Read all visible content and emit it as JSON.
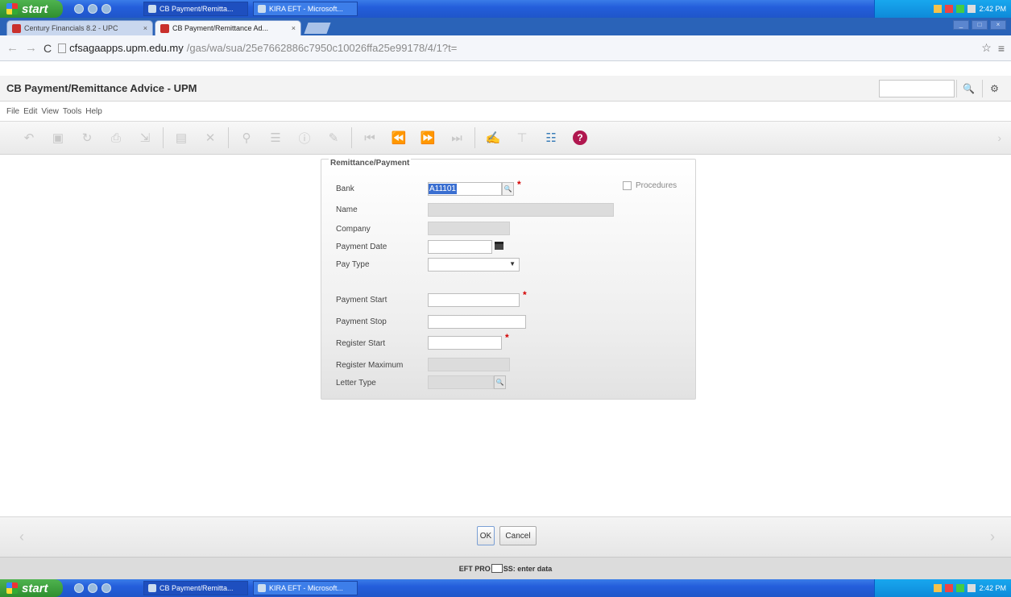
{
  "taskbar": {
    "start_label": "start",
    "tasks": [
      "CB Payment/Remitta...",
      "KIRA EFT - Microsoft..."
    ],
    "clock": "2:42 PM"
  },
  "browser": {
    "tabs": [
      {
        "title": "Century Financials 8.2 - UPC"
      },
      {
        "title": "CB Payment/Remittance Ad..."
      }
    ],
    "url_host": "cfsagaapps.upm.edu.my",
    "url_path": "/gas/wa/sua/25e7662886c7950c10026ffa25e99178/4/1?t="
  },
  "app": {
    "title": "CB Payment/Remittance Advice - UPM",
    "menu": [
      "File",
      "Edit",
      "View",
      "Tools",
      "Help"
    ]
  },
  "form": {
    "section_title": "Remittance/Payment",
    "fields": {
      "bank": {
        "label": "Bank",
        "value": "A11101"
      },
      "name": {
        "label": "Name"
      },
      "company": {
        "label": "Company"
      },
      "payment_date": {
        "label": "Payment Date"
      },
      "pay_type": {
        "label": "Pay Type"
      },
      "payment_start": {
        "label": "Payment Start"
      },
      "payment_stop": {
        "label": "Payment Stop"
      },
      "register_start": {
        "label": "Register Start"
      },
      "register_maximum": {
        "label": "Register Maximum"
      },
      "letter_type": {
        "label": "Letter Type"
      }
    },
    "procedures_label": "Procedures"
  },
  "buttons": {
    "ok": "OK",
    "cancel": "Cancel"
  },
  "status": {
    "left": "EFT PRO",
    "right": "SS: enter data"
  },
  "colors": {
    "required": "#d40000",
    "help": "#b0174f",
    "selection": "#3a6fd1"
  }
}
